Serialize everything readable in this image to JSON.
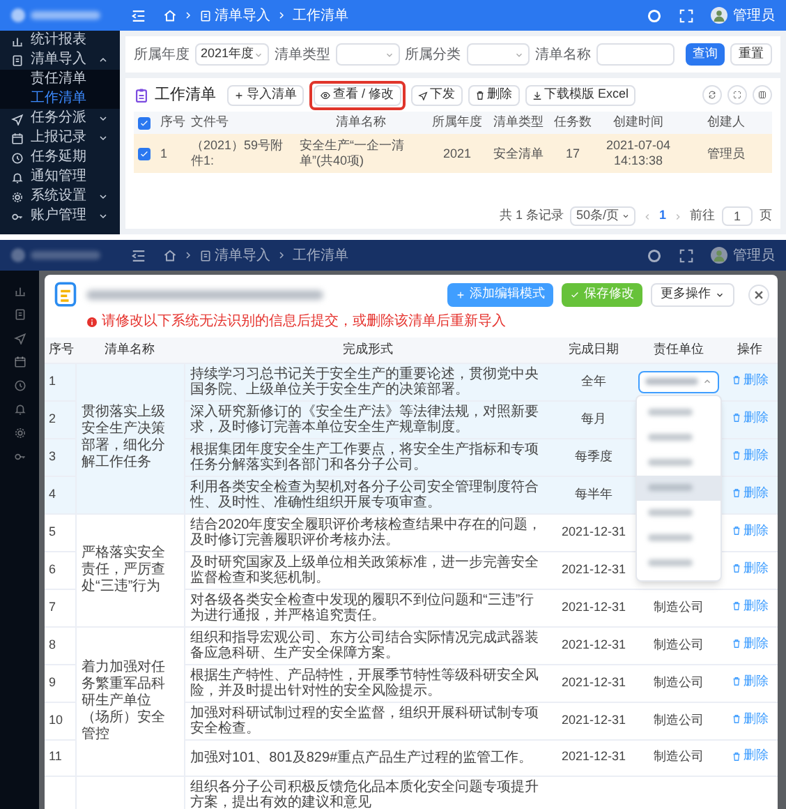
{
  "top": {
    "header": {
      "crumbs": [
        "清单导入",
        "工作清单"
      ],
      "user": "管理员"
    },
    "sidebar": [
      {
        "label": "统计报表",
        "kind": "link",
        "selected": false
      },
      {
        "label": "清单导入",
        "kind": "group",
        "selected": false,
        "expanded": true,
        "children": [
          {
            "label": "责任清单",
            "selected": false
          },
          {
            "label": "工作清单",
            "selected": true
          }
        ]
      },
      {
        "label": "任务分派",
        "kind": "group",
        "selected": false,
        "expanded": false
      },
      {
        "label": "上报记录",
        "kind": "group",
        "selected": false,
        "expanded": false
      },
      {
        "label": "任务延期",
        "kind": "link",
        "selected": false
      },
      {
        "label": "通知管理",
        "kind": "link",
        "selected": false
      },
      {
        "label": "系统设置",
        "kind": "group",
        "selected": false,
        "expanded": false
      },
      {
        "label": "账户管理",
        "kind": "group",
        "selected": false,
        "expanded": false
      }
    ],
    "filters": [
      {
        "label": "所属年度",
        "kind": "select",
        "value": "2021年度"
      },
      {
        "label": "清单类型",
        "kind": "select"
      },
      {
        "label": "所属分类",
        "kind": "select"
      },
      {
        "label": "清单名称",
        "kind": "input"
      }
    ],
    "filter_buttons": [
      {
        "label": "查询",
        "primary": true
      },
      {
        "label": "重置",
        "primary": false
      }
    ],
    "toolbar": {
      "title": "工作清单",
      "buttons": [
        {
          "label": "导入清单",
          "highlighted": false
        },
        {
          "label": "查看 / 修改",
          "highlighted": true
        },
        {
          "label": "下发",
          "highlighted": false
        },
        {
          "label": "删除",
          "highlighted": false
        },
        {
          "label": "下载模版 Excel",
          "highlighted": false
        }
      ]
    },
    "table": {
      "all_checked": true,
      "columns": [
        "序号",
        "文件号",
        "清单名称",
        "所属年度",
        "清单类型",
        "任务数",
        "创建时间",
        "创建人"
      ],
      "rows": [
        {
          "checked": true,
          "cells": [
            "1",
            "（2021）59号附件1:",
            "安全生产“一企一清单”(共40项)",
            "2021",
            "安全清单",
            "17",
            "2021-07-04 14:13:38",
            "管理员"
          ]
        }
      ]
    },
    "pagination": {
      "total": "共 1 条记录",
      "page_size": "50条/页",
      "page": "1",
      "goto": "前往",
      "goto_value": "1",
      "unit": "页"
    }
  },
  "bottom": {
    "header": {
      "crumbs": [
        "清单导入",
        "工作清单"
      ],
      "user": "管理员"
    },
    "modal": {
      "warning": "请修改以下系统无法识别的信息后提交，或删除该清单后重新导入",
      "buttons": [
        {
          "label": "添加编辑模式",
          "kind": "add"
        },
        {
          "label": "保存修改",
          "kind": "save"
        },
        {
          "label": "更多操作",
          "kind": "more"
        }
      ],
      "columns": [
        "序号",
        "清单名称",
        "完成形式",
        "完成日期",
        "责任单位",
        "操作"
      ],
      "groups": [
        {
          "name": "贯彻落实上级安全生产决策部署，细化分解工作任务",
          "highlighted": true,
          "rows": [
            {
              "no": "1",
              "form": "持续学习习总书记关于安全生产的重要论述，贯彻党中央国务院、上级单位关于安全生产的决策部署。",
              "date": "全年",
              "unit_field": {
                "expanded": true,
                "options": [
                  {
                    "selected": false
                  },
                  {
                    "selected": false
                  },
                  {
                    "selected": false
                  },
                  {
                    "selected": true
                  },
                  {
                    "selected": false
                  },
                  {
                    "selected": false
                  },
                  {
                    "selected": false
                  }
                ]
              },
              "action": "删除"
            },
            {
              "no": "2",
              "form": "深入研究新修订的《安全生产法》等法律法规，对照新要求，及时修订完善本单位安全生产规章制度。",
              "date": "每月",
              "action": "删除"
            },
            {
              "no": "3",
              "form": "根据集团年度安全生产工作要点，将安全生产指标和专项任务分解落实到各部门和各分子公司。",
              "date": "每季度",
              "action": "删除"
            },
            {
              "no": "4",
              "form": "利用各类安全检查为契机对各分子公司安全管理制度符合性、及时性、准确性组织开展专项审查。",
              "date": "每半年",
              "action": "删除"
            }
          ]
        },
        {
          "name": "严格落实安全责任，严厉查处“三违”行为",
          "highlighted": false,
          "rows": [
            {
              "no": "5",
              "form": "结合2020年度安全履职评价考核检查结果中存在的问题，及时修订完善履职评价考核办法。",
              "date": "2021-12-31",
              "action": "删除"
            },
            {
              "no": "6",
              "form": "及时研究国家及上级单位相关政策标准，进一步完善安全监督检查和奖惩机制。",
              "date": "2021-12-31",
              "action": "删除"
            },
            {
              "no": "7",
              "form": "对各级各类安全检查中发现的履职不到位问题和“三违”行为进行通报，并严格追究责任。",
              "date": "2021-12-31",
              "unit": "制造公司",
              "action": "删除"
            }
          ]
        },
        {
          "name": "着力加强对任务繁重军品科研生产单位（场所）安全管控",
          "highlighted": false,
          "rows": [
            {
              "no": "8",
              "form": "组织和指导宏观公司、东方公司结合实际情况完成武器装备应急科研、生产安全保障方案。",
              "date": "2021-12-31",
              "unit": "制造公司",
              "action": "删除"
            },
            {
              "no": "9",
              "form": "根据生产特性、产品特性，开展季节特性等级科研安全风险，并及时提出针对性的安全风险提示。",
              "date": "2021-12-31",
              "unit": "制造公司",
              "action": "删除"
            },
            {
              "no": "10",
              "form": "加强对科研试制过程的安全监督，组织开展科研试制专项安全检查。",
              "date": "2021-12-31",
              "unit": "制造公司",
              "action": "删除"
            },
            {
              "no": "11",
              "form": "加强对101、801及829#重点产品生产过程的监管工作。",
              "date": "2021-12-31",
              "unit": "制造公司",
              "action": "删除"
            }
          ]
        },
        {
          "highlighted": false,
          "rows": [
            {
              "form": "组织各分子公司积极反馈危化品本质化安全问题专项提升方案，提出有效的建议和意见"
            }
          ]
        }
      ]
    }
  }
}
